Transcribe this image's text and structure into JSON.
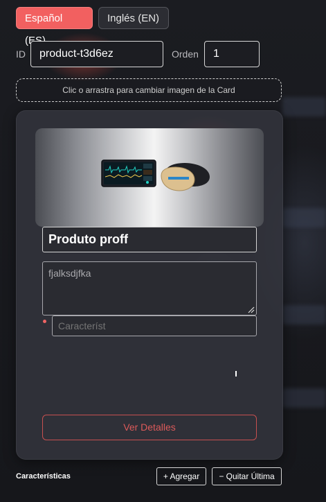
{
  "language_tabs": [
    {
      "label": "Español (ES)",
      "active": true
    },
    {
      "label": "Inglés (EN)",
      "active": false
    }
  ],
  "fields": {
    "id_label": "ID",
    "id_value": "product-t3d6ez",
    "order_label": "Orden",
    "order_value": "1"
  },
  "upload": {
    "label": "Clic o arrastra para cambiar imagen de la Card"
  },
  "card": {
    "image_icon": "product-image",
    "title_value": "Produto proff",
    "description_value": "fjalksdjfka",
    "feature_placeholder": "Característ",
    "details_button": "Ver Detalles"
  },
  "features_section": {
    "title": "Características",
    "add_button": "+ Agregar",
    "remove_button": "− Quitar Última"
  },
  "colors": {
    "accent": "#f26060",
    "card_bg": "#34363e",
    "page_bg": "#17181c"
  }
}
